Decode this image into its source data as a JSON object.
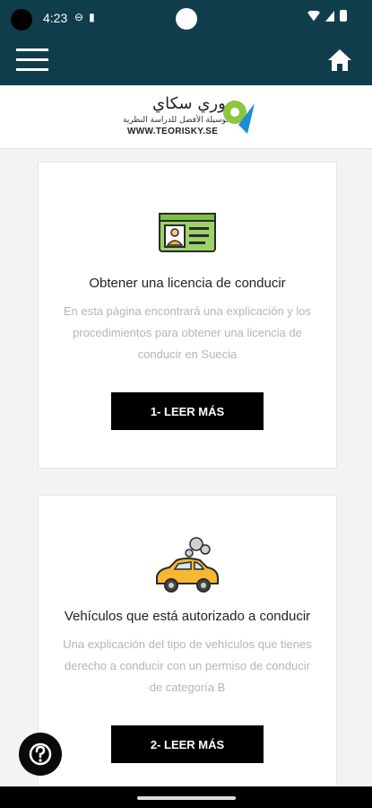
{
  "status_bar": {
    "time": "4:23"
  },
  "app_bar": {
    "menu_icon": "hamburger-menu-icon",
    "home_icon": "home-icon"
  },
  "logo": {
    "arabic_name": "تيوري سكاي",
    "arabic_tagline": "الوسيلة الأفضل للدراسة النظرية",
    "url": "WWW.TEORISKY.SE"
  },
  "cards": [
    {
      "icon": "driver-license-icon",
      "title": "Obtener una licencia de conducir",
      "description": [
        "En esta página encontrará una explicación y los",
        "procedimientos para obtener una licencia de",
        "conducir en Suecia"
      ],
      "button_label": "1- LEER MÁS"
    },
    {
      "icon": "car-icon",
      "title": "Vehículos que está autorizado a conducir",
      "description": [
        "Una explicación del tipo de vehículos que tienes",
        "derecho a conducir con un permiso de conducir",
        "de categoría B"
      ],
      "button_label": "2- LEER MÁS"
    }
  ],
  "help_button": {
    "icon": "question-mark-icon"
  },
  "colors": {
    "header": "#0f3d4b",
    "button": "#000000",
    "license_green": "#9bd26a",
    "car_yellow": "#f7b731"
  }
}
